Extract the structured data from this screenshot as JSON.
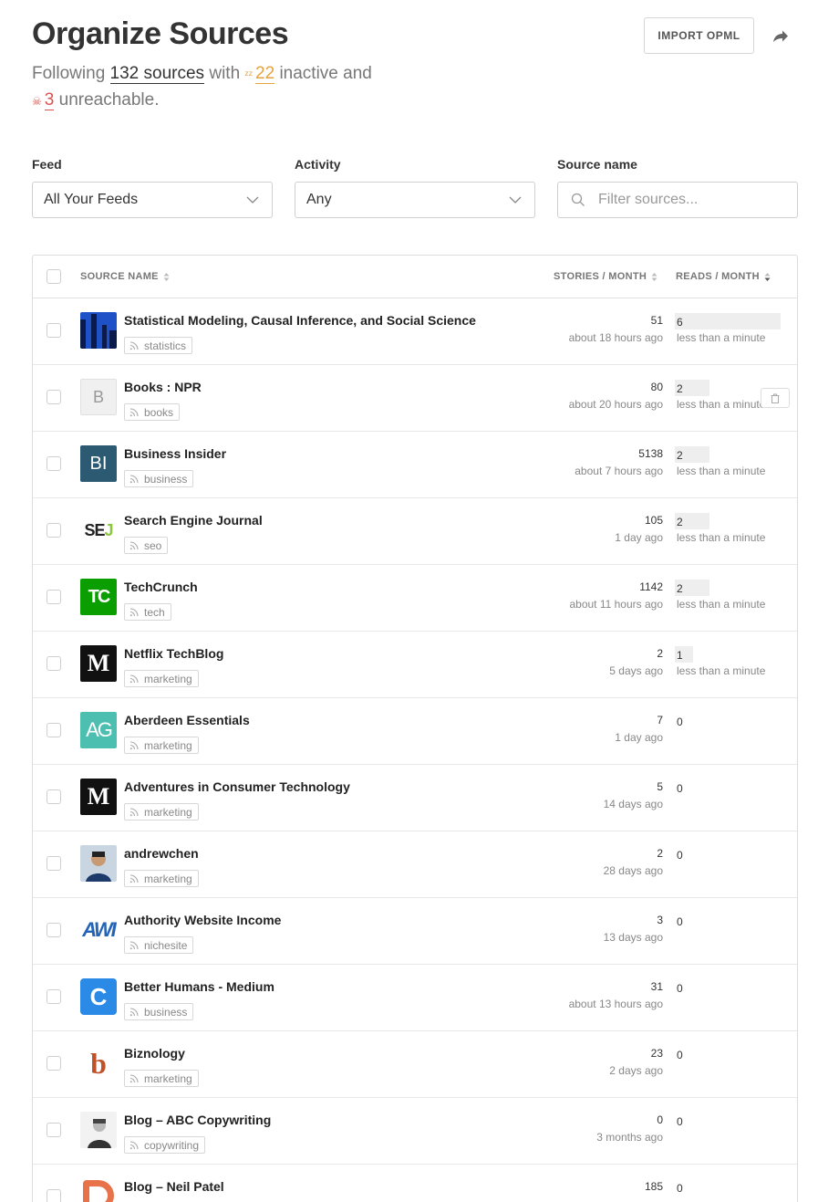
{
  "page": {
    "title": "Organize Sources",
    "import_label": "IMPORT OPML",
    "summary": {
      "prefix": "Following",
      "sources_link": "132 sources",
      "mid": "with",
      "inactive_count": "22",
      "inactive_suffix": "inactive and",
      "unreachable_count": "3",
      "unreachable_suffix": "unreachable."
    }
  },
  "filters": {
    "feed": {
      "label": "Feed",
      "value": "All Your Feeds"
    },
    "activity": {
      "label": "Activity",
      "value": "Any"
    },
    "source_name": {
      "label": "Source name",
      "placeholder": "Filter sources..."
    }
  },
  "table": {
    "columns": {
      "source_name": "SOURCE NAME",
      "stories": "STORIES / MONTH",
      "reads": "READS / MONTH"
    },
    "rows": [
      {
        "name": "Statistical Modeling, Causal Inference, and Social Science",
        "tag": "statistics",
        "stories": "51",
        "ago": "about 18 hours ago",
        "reads": "6",
        "reads_fraction": 1.0,
        "reads_time": "less than a minute",
        "icon": "bars-logo-icon"
      },
      {
        "name": "Books : NPR",
        "tag": "books",
        "stories": "80",
        "ago": "about 20 hours ago",
        "reads": "2",
        "reads_fraction": 0.33,
        "reads_time": "less than a minute",
        "icon": "letter-b-icon",
        "letter": "B"
      },
      {
        "name": "Business Insider",
        "tag": "business",
        "stories": "5138",
        "ago": "about 7 hours ago",
        "reads": "2",
        "reads_fraction": 0.33,
        "reads_time": "less than a minute",
        "icon": "bi-logo-icon",
        "letter": "BI"
      },
      {
        "name": "Search Engine Journal",
        "tag": "seo",
        "stories": "105",
        "ago": "1 day ago",
        "reads": "2",
        "reads_fraction": 0.33,
        "reads_time": "less than a minute",
        "icon": "sej-logo-icon",
        "letter": "SEJ"
      },
      {
        "name": "TechCrunch",
        "tag": "tech",
        "stories": "1142",
        "ago": "about 11 hours ago",
        "reads": "2",
        "reads_fraction": 0.33,
        "reads_time": "less than a minute",
        "icon": "techcrunch-logo-icon",
        "letter": "TC"
      },
      {
        "name": "Netflix TechBlog",
        "tag": "marketing",
        "stories": "2",
        "ago": "5 days ago",
        "reads": "1",
        "reads_fraction": 0.17,
        "reads_time": "less than a minute",
        "icon": "medium-logo-icon",
        "letter": "M"
      },
      {
        "name": "Aberdeen Essentials",
        "tag": "marketing",
        "stories": "7",
        "ago": "1 day ago",
        "reads": "0",
        "reads_fraction": 0,
        "reads_time": "",
        "icon": "aberdeen-logo-icon",
        "letter": "AG"
      },
      {
        "name": "Adventures in Consumer Technology",
        "tag": "marketing",
        "stories": "5",
        "ago": "14 days ago",
        "reads": "0",
        "reads_fraction": 0,
        "reads_time": "",
        "icon": "medium-logo-icon",
        "letter": "M"
      },
      {
        "name": "andrewchen",
        "tag": "marketing",
        "stories": "2",
        "ago": "28 days ago",
        "reads": "0",
        "reads_fraction": 0,
        "reads_time": "",
        "icon": "person-avatar-icon"
      },
      {
        "name": "Authority Website Income",
        "tag": "nichesite",
        "stories": "3",
        "ago": "13 days ago",
        "reads": "0",
        "reads_fraction": 0,
        "reads_time": "",
        "icon": "awi-logo-icon",
        "letter": "AWI"
      },
      {
        "name": "Better Humans - Medium",
        "tag": "business",
        "stories": "31",
        "ago": "about 13 hours ago",
        "reads": "0",
        "reads_fraction": 0,
        "reads_time": "",
        "icon": "c-logo-icon",
        "letter": "C"
      },
      {
        "name": "Biznology",
        "tag": "marketing",
        "stories": "23",
        "ago": "2 days ago",
        "reads": "0",
        "reads_fraction": 0,
        "reads_time": "",
        "icon": "biznology-logo-icon",
        "letter": "b"
      },
      {
        "name": "Blog – ABC Copywriting",
        "tag": "copywriting",
        "stories": "0",
        "ago": "3 months ago",
        "reads": "0",
        "reads_fraction": 0,
        "reads_time": "",
        "icon": "person-photo-icon"
      },
      {
        "name": "Blog – Neil Patel",
        "tag": "",
        "stories": "185",
        "ago": "",
        "reads": "0",
        "reads_fraction": 0,
        "reads_time": "",
        "icon": "neilpatel-logo-icon",
        "letter": "D"
      }
    ]
  },
  "colors": {
    "inactive": "#e6a23c",
    "unreachable": "#d9534f"
  }
}
